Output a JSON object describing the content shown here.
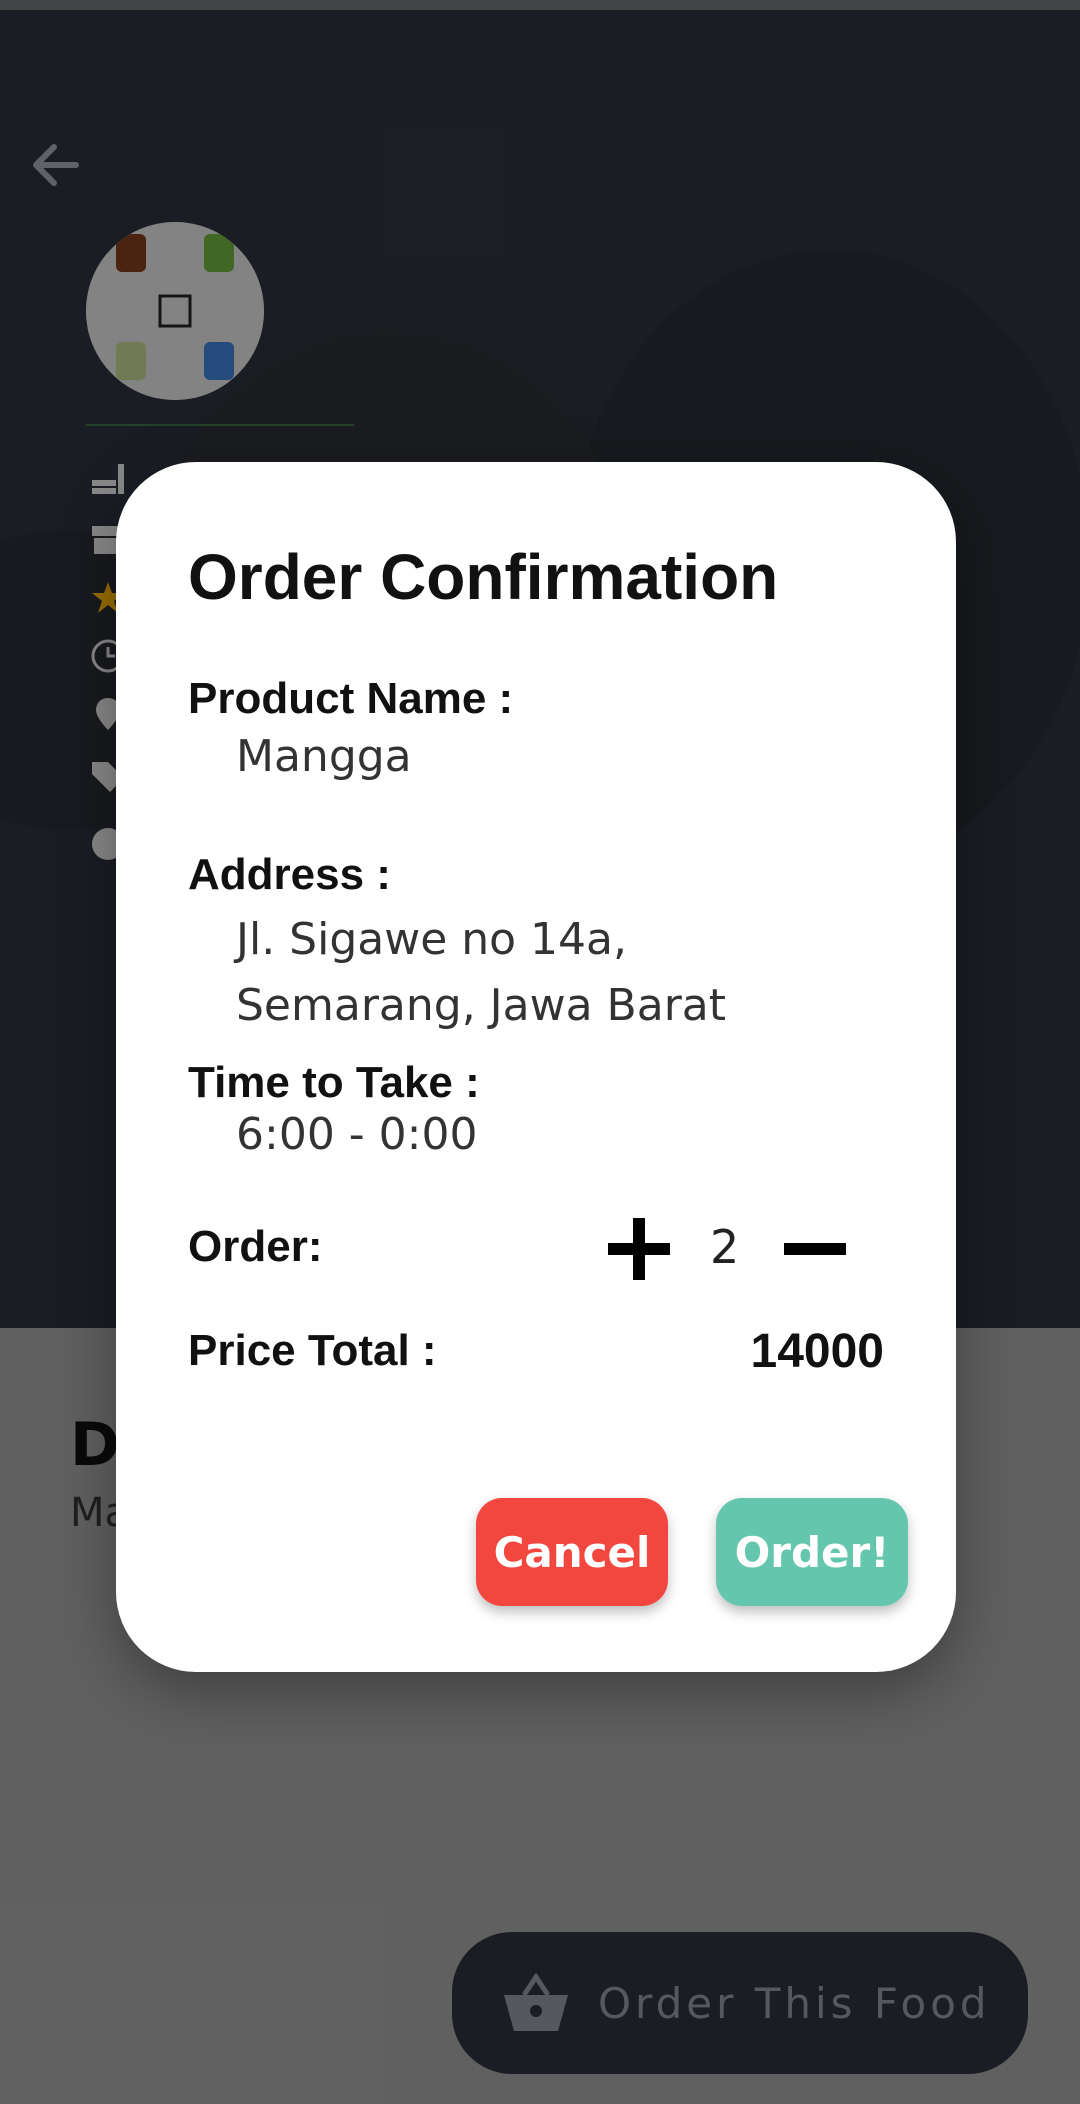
{
  "dialog": {
    "title": "Order Confirmation",
    "product_label": "Product Name :",
    "product_value": "Mangga",
    "address_label": "Address :",
    "address_line1": "Jl. Sigawe no 14a,",
    "address_line2": "Semarang, Jawa Barat",
    "time_label": "Time to Take :",
    "time_value": "6:00 - 0:00",
    "order_label": "Order:",
    "quantity": "2",
    "price_label": "Price Total :",
    "price_value": "14000",
    "cancel_label": "Cancel",
    "order_button_label": "Order!"
  },
  "background": {
    "title_partial": "D",
    "subtitle_partial": "Ma",
    "fab_label": "Order This Food"
  },
  "colors": {
    "cancel": "#f2473f",
    "order": "#65c6ae",
    "star": "#f5b301",
    "hero": "#2b303a"
  },
  "icons": [
    "back-arrow-icon",
    "food-icon",
    "store-icon",
    "star-icon",
    "clock-icon",
    "location-icon",
    "tag-icon",
    "info-icon",
    "plus-icon",
    "minus-icon",
    "basket-icon"
  ]
}
